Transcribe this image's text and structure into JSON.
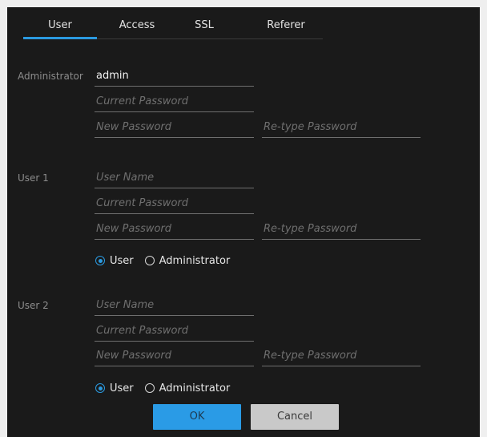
{
  "tabs": [
    {
      "label": "User",
      "active": true
    },
    {
      "label": "Access",
      "active": false
    },
    {
      "label": "SSL",
      "active": false
    },
    {
      "label": "Referer",
      "active": false
    }
  ],
  "administrator": {
    "label": "Administrator",
    "user_name_value": "admin",
    "current_password_placeholder": "Current Password",
    "new_password_placeholder": "New Password",
    "retype_password_placeholder": "Re-type Password"
  },
  "users": [
    {
      "label": "User 1",
      "user_name_placeholder": "User Name",
      "current_password_placeholder": "Current Password",
      "new_password_placeholder": "New Password",
      "retype_password_placeholder": "Re-type Password",
      "role_user_label": "User",
      "role_admin_label": "Administrator",
      "selected_role": "User"
    },
    {
      "label": "User 2",
      "user_name_placeholder": "User Name",
      "current_password_placeholder": "Current Password",
      "new_password_placeholder": "New Password",
      "retype_password_placeholder": "Re-type Password",
      "role_user_label": "User",
      "role_admin_label": "Administrator",
      "selected_role": "User"
    }
  ],
  "buttons": {
    "ok_label": "OK",
    "cancel_label": "Cancel"
  },
  "colors": {
    "accent": "#2b9ae0",
    "background": "#1a1a1a",
    "cancel": "#c9c9c9"
  }
}
